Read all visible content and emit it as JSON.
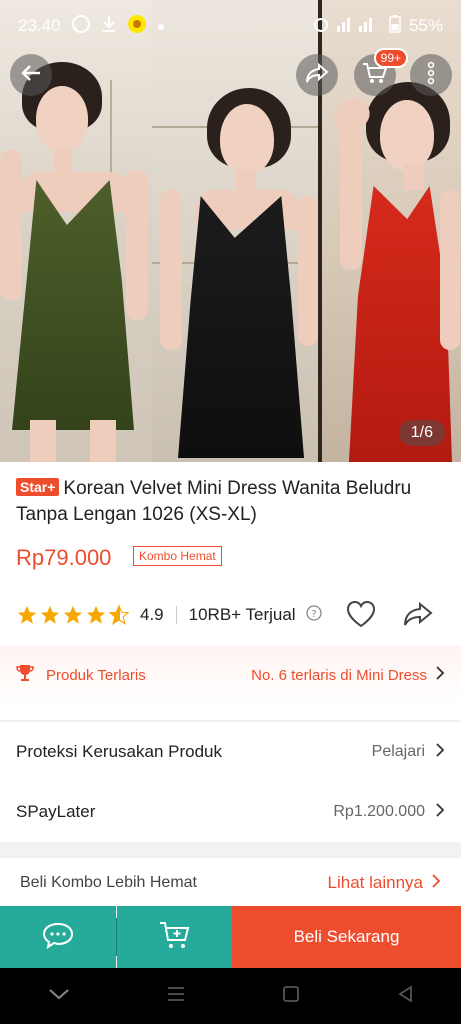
{
  "status_bar": {
    "time": "23.40",
    "battery": "55%"
  },
  "hero": {
    "page_indicator": "1/6",
    "cart_badge": "99+"
  },
  "product": {
    "badge": "Star+",
    "title": "Korean Velvet Mini Dress Wanita Beludru Tanpa Lengan 1026 (XS-XL)",
    "price": "Rp79.000",
    "promo_tag": "Kombo Hemat",
    "rating_value": "4.9",
    "rating_stars": 4.5,
    "sold": "10RB+ Terjual"
  },
  "bestseller": {
    "label": "Produk Terlaris",
    "rank_text": "No. 6 terlaris di Mini Dress"
  },
  "rows": [
    {
      "label": "Proteksi Kerusakan Produk",
      "value": "Pelajari"
    },
    {
      "label": "SPayLater",
      "value": "Rp1.200.000"
    }
  ],
  "kombo_section": {
    "label": "Beli Kombo Lebih Hemat",
    "more": "Lihat lainnya"
  },
  "bottom_bar": {
    "buy_label": "Beli Sekarang"
  },
  "colors": {
    "accent": "#ee4d2d",
    "teal": "#26aa99",
    "star": "#f6a700"
  }
}
